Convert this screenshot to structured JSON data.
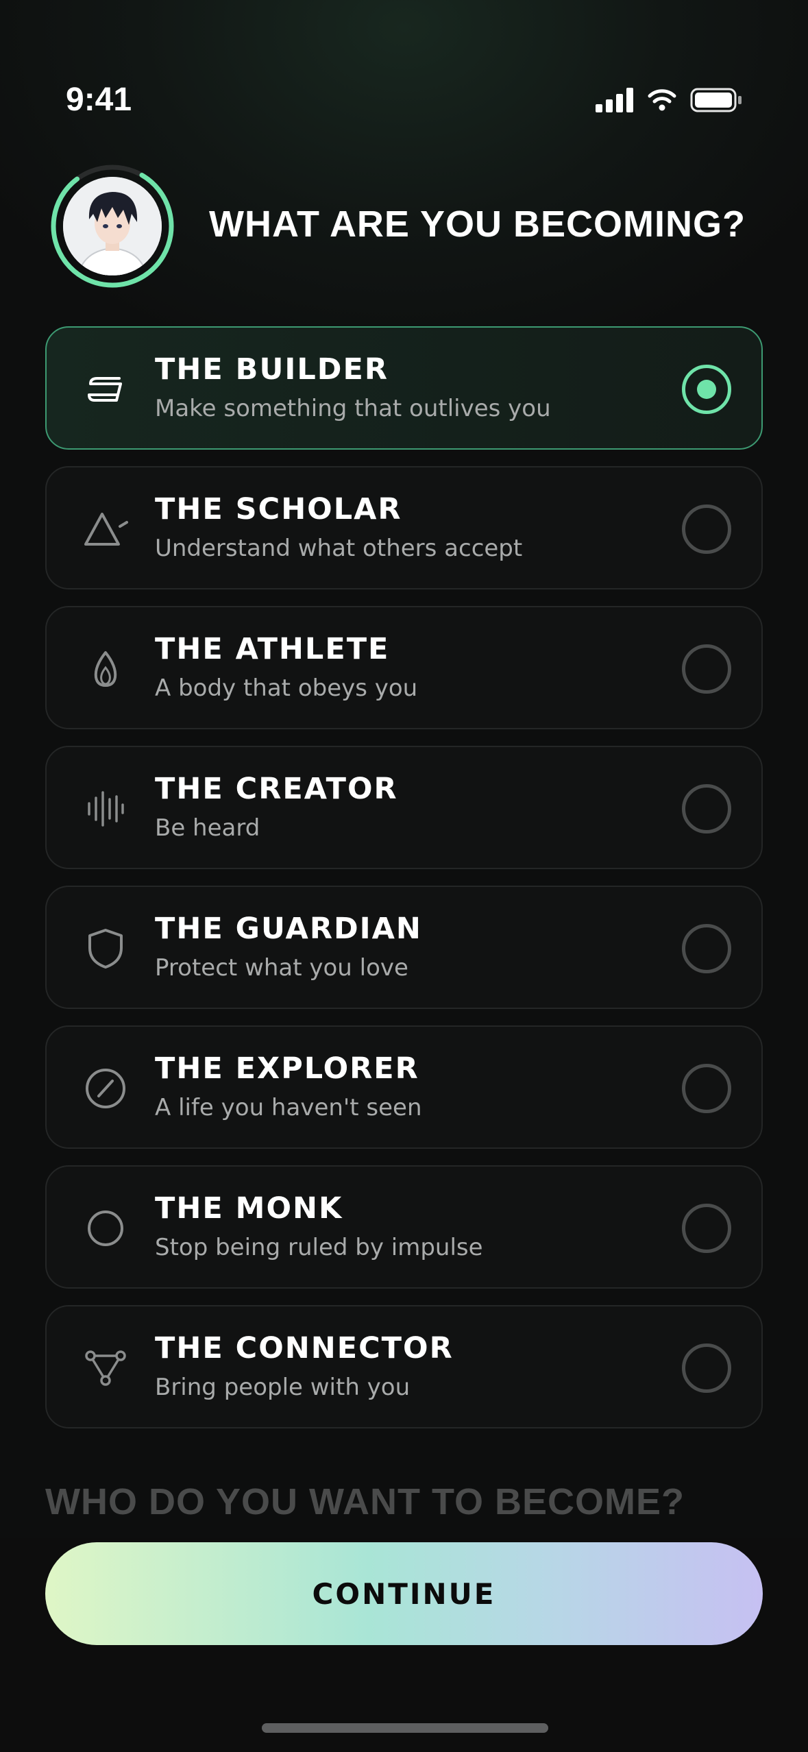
{
  "status_bar": {
    "time": "9:41"
  },
  "header": {
    "title": "WHAT ARE YOU BECOMING?"
  },
  "options": [
    {
      "title": "THE BUILDER",
      "subtitle": "Make something that outlives you",
      "icon": "builder-icon",
      "selected": true
    },
    {
      "title": "THE SCHOLAR",
      "subtitle": "Understand what others accept",
      "icon": "triangle-icon",
      "selected": false
    },
    {
      "title": "THE ATHLETE",
      "subtitle": "A body that obeys you",
      "icon": "flame-icon",
      "selected": false
    },
    {
      "title": "THE CREATOR",
      "subtitle": "Be heard",
      "icon": "soundwave-icon",
      "selected": false
    },
    {
      "title": "THE GUARDIAN",
      "subtitle": "Protect what you love",
      "icon": "shield-icon",
      "selected": false
    },
    {
      "title": "THE EXPLORER",
      "subtitle": "A life you haven't seen",
      "icon": "compass-icon",
      "selected": false
    },
    {
      "title": "THE MONK",
      "subtitle": "Stop being ruled by impulse",
      "icon": "circle-icon",
      "selected": false
    },
    {
      "title": "THE CONNECTOR",
      "subtitle": "Bring people with you",
      "icon": "network-icon",
      "selected": false
    }
  ],
  "next_question": "WHO DO YOU WANT TO BECOME?",
  "continue_label": "CONTINUE",
  "colors": {
    "accent": "#6fe3a9",
    "selected_border": "#3d9a72",
    "background": "#0d0e0e",
    "card": "#111212"
  }
}
